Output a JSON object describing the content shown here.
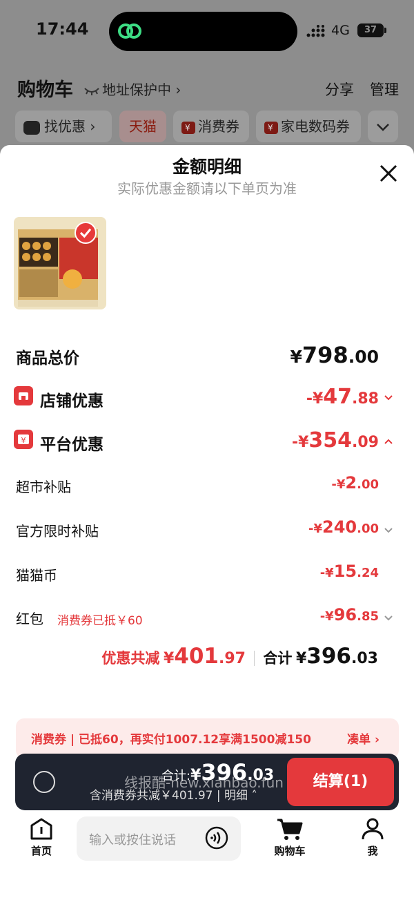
{
  "status": {
    "time": "17:44",
    "network": "4G",
    "battery": "37"
  },
  "header": {
    "title": "购物车",
    "address_protect": "地址保护中",
    "share": "分享",
    "manage": "管理"
  },
  "chips": [
    "找优惠",
    "天猫",
    "消费券",
    "家电数码券"
  ],
  "sheet": {
    "title": "金额明细",
    "subtitle": "实际优惠金额请以下单页为准",
    "rows": {
      "goods_total": {
        "label": "商品总价",
        "yen": "¥",
        "int": "798",
        "dec": ".00"
      },
      "store_discount": {
        "label": "店铺优惠",
        "yen": "-¥",
        "int": "47",
        "dec": ".88"
      },
      "platform_discount": {
        "label": "平台优惠",
        "yen": "-¥",
        "int": "354",
        "dec": ".09"
      },
      "supermarket_subsidy": {
        "label": "超市补贴",
        "yen": "-¥",
        "int": "2",
        "dec": ".00"
      },
      "official_subsidy": {
        "label": "官方限时补贴",
        "yen": "-¥",
        "int": "240",
        "dec": ".00"
      },
      "cat_coins": {
        "label": "猫猫币",
        "yen": "-¥",
        "int": "15",
        "dec": ".24"
      },
      "red_packet": {
        "label": "红包",
        "note": "消费券已抵￥60",
        "yen": "-¥",
        "int": "96",
        "dec": ".85"
      }
    },
    "summary": {
      "saved_label": "优惠共减",
      "saved_yen": "¥",
      "saved_int": "401",
      "saved_dec": ".97",
      "total_label": "合计",
      "total_yen": "¥",
      "total_int": "396",
      "total_dec": ".03"
    },
    "coupon_bar": {
      "tag": "消费券",
      "text": "已抵60，再实付1007.12享满1500减150",
      "action": "凑单"
    }
  },
  "checkout": {
    "total_label": "合计:",
    "total_yen": "¥",
    "total_int": "396",
    "total_dec": ".03",
    "sub": "含消费券共减￥401.97",
    "detail": "明细",
    "pay": "结算(1)"
  },
  "watermark": "线报酷-new.xianbao.fun",
  "tabbar": {
    "home": "首页",
    "voice_placeholder": "输入或按住说话",
    "cart": "购物车",
    "me": "我"
  },
  "colors": {
    "accent": "#e4393c",
    "checkout_bg": "#1f2430"
  }
}
